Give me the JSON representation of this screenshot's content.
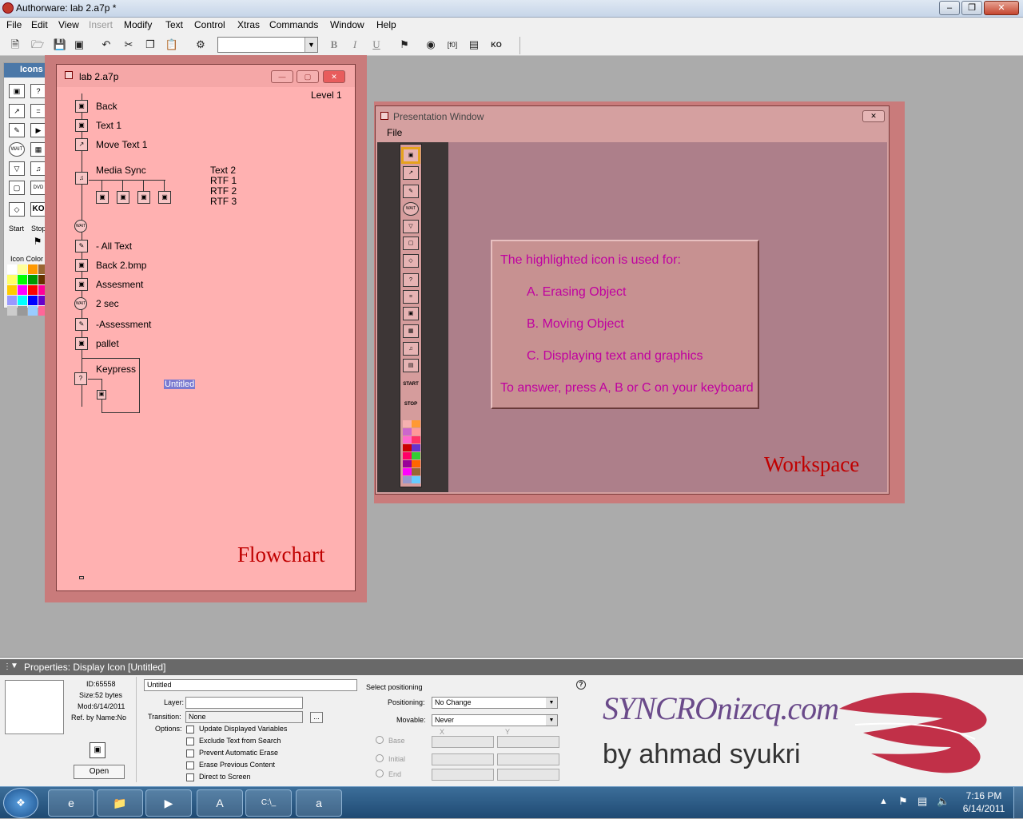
{
  "app": {
    "title": "Authorware: lab 2.a7p *"
  },
  "menu": [
    "File",
    "Edit",
    "View",
    "Insert",
    "Modify",
    "Text",
    "Control",
    "Xtras",
    "Commands",
    "Window",
    "Help"
  ],
  "toolbar": {
    "bold": "B",
    "italic": "I",
    "underline": "U"
  },
  "icons_palette": {
    "title": "Icons",
    "start": "Start",
    "stop": "Stop",
    "icon_color": "Icon Color",
    "wait": "WAIT",
    "dvd": "DVD",
    "ko": "KO",
    "colors": [
      "#ffffff",
      "#ffff99",
      "#ff9900",
      "#996633",
      "#ffff66",
      "#00ff00",
      "#009900",
      "#663300",
      "#ffcc00",
      "#ff00ff",
      "#ff0000",
      "#ff0099",
      "#9999ff",
      "#00ffff",
      "#0000ff",
      "#6600cc",
      "#cccccc",
      "#999999",
      "#99ccff",
      "#ff6699"
    ]
  },
  "flowchart": {
    "title": "lab 2.a7p",
    "level": "Level 1",
    "overlay_label": "Flowchart",
    "icons": [
      "Back",
      "Text 1",
      "Move Text 1",
      "Media Sync",
      "- All Text",
      "Back 2.bmp",
      "Assesment",
      "2 sec",
      "-Assessment",
      "pallet",
      "Keypress"
    ],
    "media_sync_targets": [
      "Text 2",
      "RTF 1",
      "RTF 2",
      "RTF 3"
    ],
    "untitled": "Untitled",
    "wait": "WAIT"
  },
  "presentation": {
    "title": "Presentation Window",
    "menu_file": "File",
    "overlay_label": "Workspace",
    "wait": "WAIT",
    "start": "START",
    "stop": "STOP",
    "question": {
      "prompt": "The highlighted icon is used for:",
      "a": "A.  Erasing Object",
      "b": "B.  Moving Object",
      "c": "C. Displaying text and graphics",
      "instruction": "To answer, press A, B or C on your keyboard"
    },
    "colors": [
      "#f5b0b0",
      "#ff9933",
      "#cc66cc",
      "#ff9999",
      "#ff66cc",
      "#ff3366",
      "#cc0000",
      "#6633cc",
      "#ff0066",
      "#33cc33",
      "#990099",
      "#ff6600",
      "#ff00ff",
      "#996633",
      "#9999cc",
      "#66ccff"
    ]
  },
  "properties": {
    "header": "Properties: Display Icon [Untitled]",
    "id": "ID:65558",
    "size": "Size:52 bytes",
    "mod": "Mod:6/14/2011",
    "ref": "Ref. by Name:No",
    "open": "Open",
    "name_value": "Untitled",
    "layer_label": "Layer:",
    "transition_label": "Transition:",
    "transition_value": "None",
    "options_label": "Options:",
    "options": [
      "Update Displayed Variables",
      "Exclude Text from Search",
      "Prevent Automatic Erase",
      "Erase Previous Content",
      "Direct to Screen"
    ],
    "select_positioning": "Select positioning",
    "positioning_label": "Positioning:",
    "positioning_value": "No Change",
    "movable_label": "Movable:",
    "movable_value": "Never",
    "x": "X",
    "y": "Y",
    "base": "Base",
    "initial": "Initial",
    "end": "End",
    "help": "?",
    "more": "..."
  },
  "watermark": {
    "brand": "SYNCROnizcq.com",
    "author": "by ahmad syukri"
  },
  "taskbar": {
    "time": "7:16 PM",
    "date": "6/14/2011",
    "cmd": "C:\\_"
  }
}
